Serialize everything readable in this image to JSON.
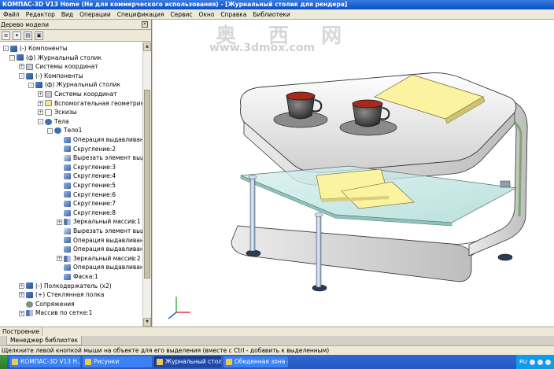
{
  "window": {
    "title": "КОМПАС-3D V13 Home (Не для коммерческого использования) - [Журнальный столик для рендера]"
  },
  "menu": [
    "Файл",
    "Редактор",
    "Вид",
    "Операции",
    "Спецификация",
    "Сервис",
    "Окно",
    "Справка",
    "Библиотеки"
  ],
  "panel": {
    "title": "Дерево модели",
    "pin": "×"
  },
  "tree": [
    {
      "label": "(-) Компоненты",
      "icon": "comp",
      "exp": "-"
    },
    {
      "label": "(ф) Журнальный столик",
      "icon": "comp",
      "exp": "-"
    },
    {
      "label": "Системы координат",
      "icon": "sys",
      "exp": "+"
    },
    {
      "label": "(-) Компоненты",
      "icon": "comp",
      "exp": "-"
    },
    {
      "label": "(ф) Журнальный столик",
      "icon": "comp",
      "exp": "-"
    },
    {
      "label": "Системы координат",
      "icon": "sys",
      "exp": "+"
    },
    {
      "label": "Вспомогательная геометрия",
      "icon": "geom",
      "exp": "+"
    },
    {
      "label": "Эскизы",
      "icon": "sketch",
      "exp": "+"
    },
    {
      "label": "Тела",
      "icon": "body",
      "exp": "-"
    },
    {
      "label": "Тело1",
      "icon": "body",
      "exp": "-"
    },
    {
      "label": "Операция выдавливания",
      "icon": "op",
      "exp": ""
    },
    {
      "label": "Скругление:2",
      "icon": "op",
      "exp": ""
    },
    {
      "label": "Вырезать элемент выдавливания",
      "icon": "cut",
      "exp": ""
    },
    {
      "label": "Скругление:3",
      "icon": "op",
      "exp": ""
    },
    {
      "label": "Скругление:4",
      "icon": "op",
      "exp": ""
    },
    {
      "label": "Скругление:5",
      "icon": "op",
      "exp": ""
    },
    {
      "label": "Скругление:6",
      "icon": "op",
      "exp": ""
    },
    {
      "label": "Скругление:7",
      "icon": "op",
      "exp": ""
    },
    {
      "label": "Скругление:8",
      "icon": "op",
      "exp": ""
    },
    {
      "label": "Зеркальный массив:1",
      "icon": "mirror",
      "exp": "+"
    },
    {
      "label": "Вырезать элемент выдавливания",
      "icon": "cut",
      "exp": ""
    },
    {
      "label": "Операция выдавливания",
      "icon": "op",
      "exp": ""
    },
    {
      "label": "Операция выдавливания",
      "icon": "op",
      "exp": ""
    },
    {
      "label": "Зеркальный массив:2",
      "icon": "mirror",
      "exp": "+"
    },
    {
      "label": "Операция выдавливания",
      "icon": "op",
      "exp": ""
    },
    {
      "label": "Фаска:1",
      "icon": "op",
      "exp": ""
    },
    {
      "label": "(-) Полкодержатель (x2)",
      "icon": "comp",
      "exp": "+"
    },
    {
      "label": "(+) Стеклянная полка",
      "icon": "comp",
      "exp": "+"
    },
    {
      "label": "Сопряжения",
      "icon": "link",
      "exp": ""
    },
    {
      "label": "Массив по сетке:1",
      "icon": "mirror",
      "exp": "+"
    }
  ],
  "tabs": {
    "top": "Построение",
    "bottom": "Менеджер библиотек"
  },
  "status": "Щелкните левой кнопкой мыши на объекте для его выделения (вместе с Ctrl - добавить к выделенным)",
  "taskbar": {
    "buttons": [
      "КОМПАС-3D V13 H...",
      "Рисунки",
      "Журнальный столик",
      "Обеденная зона - P..."
    ],
    "lang": "RU"
  },
  "watermark": {
    "cn": "奥 西 网",
    "url": "www.3dmox.com"
  },
  "colors": {
    "titlebar": "#0a4fc4",
    "taskbar": "#2457c2",
    "glass": "#bfe6e2",
    "paper": "#fbf3a0"
  }
}
